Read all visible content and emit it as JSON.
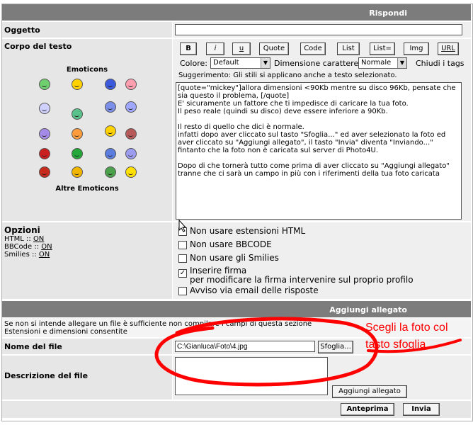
{
  "form": {
    "header": "Rispondi",
    "subject_label": "Oggetto",
    "subject_value": "",
    "body_label": "Corpo del testo",
    "emoticons_title": "Emoticons",
    "more_emoticons": "Altre Emoticons",
    "toolbar": {
      "b": "B",
      "i": "i",
      "u": "u",
      "quote": "Quote",
      "code": "Code",
      "list": "List",
      "list_eq": "List=",
      "img": "Img",
      "url": "URL"
    },
    "color_label": "Colore:",
    "color_value": "Default",
    "size_label": "Dimensione carattere:",
    "size_value": "Normale",
    "close_tags": "Chiudi i tags",
    "hint": "Suggerimento: Gli stili si applicano anche a testo selezionato.",
    "message": "[quote=\"mickey\"]allora dimensioni <90Kb mentre su disco 96Kb, pensate che sia questo il problema, [/quote]\nE' sicuramente un fattore che ti impedisce di caricare la tua foto.\nIl peso reale (quindi su disco) deve essere inferiore a 90Kb.\n\nIl resto di quello che dici è normale.\ninfatti dopo aver cliccato sul tasto \"Sfoglia...\" ed aver selezionato la foto ed aver cliccato su \"Aggiungi allegato\", il tasto \"Invia\" diventa \"Inviando...\" fintanto che la foto non è caricata sul server di Photo4U.\n\nDopo di che tornerà tutto come prima di aver cliccato su \"Aggiungi allegato\" tranne che ci sarà un campo in più con i riferimenti della tua foto caricata"
  },
  "options": {
    "title": "Opzioni",
    "html_label": "HTML ::",
    "html_val": "ON",
    "bbcode_label": "BBCode ::",
    "bbcode_val": "ON",
    "smilies_label": "Smilies ::",
    "smilies_val": "ON",
    "opt1": "Non usare estensioni HTML",
    "opt2": "Non usare BBCODE",
    "opt3": "Non usare gli Smilies",
    "opt4": "Inserire firma",
    "opt4_sub": "per modificare la firma intervenire sul proprio profilo",
    "opt5": "Avviso via email delle risposte",
    "checked": [
      false,
      false,
      false,
      true,
      false
    ]
  },
  "attach": {
    "header": "Aggiungi allegato",
    "note": "Se non si intende allegare un file è sufficiente non compilare i campi di questa sezione",
    "link": "Estensioni e dimensioni consentite",
    "file_label": "Nome del file",
    "file_value": "C:\\Gianluca\\Foto\\4.jpg",
    "browse": "Sfoglia...",
    "desc_label": "Descrizione del file",
    "add_button": "Aggiungi allegato",
    "annotation_line1": "Scegli la foto col",
    "annotation_line2": "tasto sfoglia"
  },
  "footer": {
    "preview": "Anteprima",
    "send": "Invia"
  },
  "colors": {
    "header": "#7c7c7c",
    "label_bg": "#e6e6e6",
    "annotation": "#ff0000"
  }
}
